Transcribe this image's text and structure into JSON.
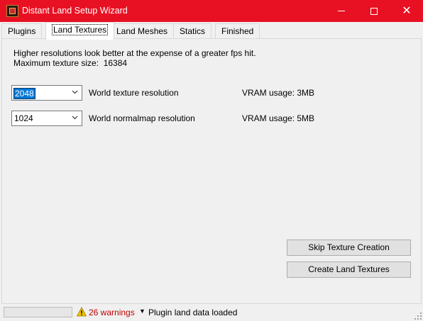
{
  "window": {
    "title": "Distant Land Setup Wizard"
  },
  "tabs": [
    {
      "label": "Plugins"
    },
    {
      "label": "Land Textures"
    },
    {
      "label": "Land Meshes"
    },
    {
      "label": "Statics"
    },
    {
      "label": "Finished"
    }
  ],
  "active_tab": "Land Textures",
  "panel": {
    "intro_line": "Higher resolutions look better at the expense of a greater fps hit.",
    "max_texture_label": "Maximum texture size:",
    "max_texture_value": "16384",
    "world_texture": {
      "value": "2048",
      "label": "World texture resolution",
      "vram": "VRAM usage: 3MB"
    },
    "world_normalmap": {
      "value": "1024",
      "label": "World normalmap resolution",
      "vram": "VRAM usage: 5MB"
    },
    "skip_button": "Skip Texture Creation",
    "create_button": "Create Land Textures"
  },
  "status": {
    "progress": 0,
    "warnings": "26 warnings",
    "message": "Plugin land data loaded"
  },
  "colors": {
    "titlebar": "#e81123",
    "warning_text": "#c00000",
    "selection": "#0078d7"
  },
  "icons": {
    "app": "app-icon",
    "warning": "warning-icon",
    "dropdown": "chevron-down-icon"
  }
}
